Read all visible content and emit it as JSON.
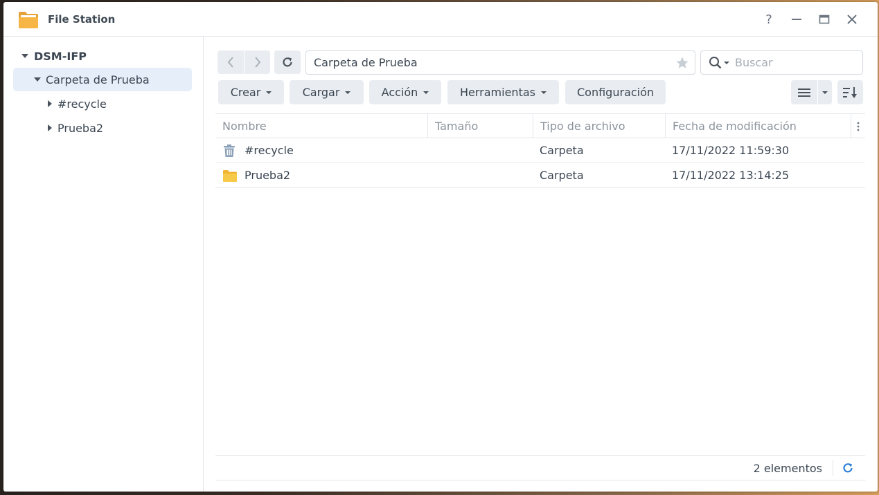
{
  "window": {
    "title": "File Station",
    "controls": [
      "help-icon",
      "minimize-icon",
      "maximize-icon",
      "close-icon"
    ]
  },
  "sidebar": {
    "root": "DSM-IFP",
    "items": [
      {
        "label": "Carpeta de Prueba",
        "expanded": true,
        "selected": true
      },
      {
        "label": "#recycle",
        "expanded": false
      },
      {
        "label": "Prueba2",
        "expanded": false
      }
    ]
  },
  "toolbar": {
    "path": "Carpeta de Prueba",
    "search_placeholder": "Buscar",
    "buttons": {
      "create": "Crear",
      "upload": "Cargar",
      "action": "Acción",
      "tools": "Herramientas",
      "settings": "Configuración"
    }
  },
  "table": {
    "columns": [
      "Nombre",
      "Tamaño",
      "Tipo de archivo",
      "Fecha de modificación"
    ],
    "rows": [
      {
        "icon": "trash-icon",
        "name": "#recycle",
        "size": "",
        "type": "Carpeta",
        "modified": "17/11/2022 11:59:30"
      },
      {
        "icon": "folder-icon",
        "name": "Prueba2",
        "size": "",
        "type": "Carpeta",
        "modified": "17/11/2022 13:14:25"
      }
    ]
  },
  "footer": {
    "count": "2 elementos"
  },
  "colors": {
    "accent": "#2f7fd7",
    "selected_bg": "#e6eef9",
    "folder": "#f5c242"
  }
}
